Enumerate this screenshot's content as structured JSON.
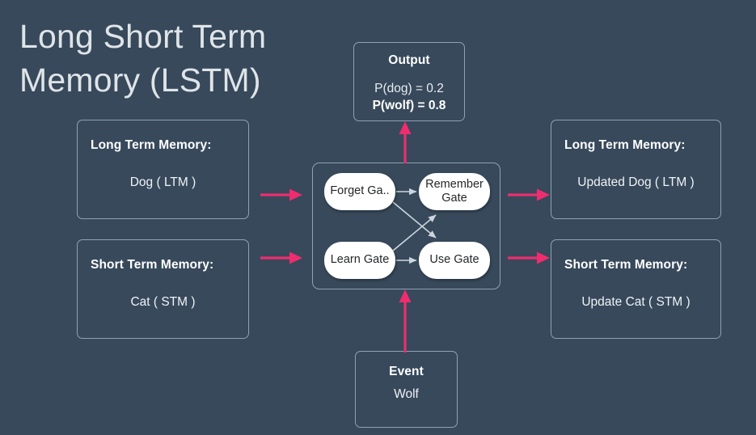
{
  "slide": {
    "title": "Long Short Term\nMemory (LSTM)",
    "background_color": "#37495b",
    "accent_color": "#ee2d6e",
    "box_border_color": "#8fa2b4",
    "gate_fill_color": "#ffffff",
    "text_color": "#ffffff"
  },
  "output_box": {
    "heading": "Output",
    "line1": "P(dog) = 0.2",
    "line2": "P(wolf) = 0.8"
  },
  "event_box": {
    "heading": "Event",
    "body": "Wolf"
  },
  "inputs": {
    "long_term_memory": {
      "heading": "Long Term Memory:",
      "body": "Dog ( LTM )"
    },
    "short_term_memory": {
      "heading": "Short Term Memory:",
      "body": "Cat ( STM )"
    }
  },
  "outputs": {
    "long_term_memory": {
      "heading": "Long Term Memory:",
      "body": "Updated Dog ( LTM )"
    },
    "short_term_memory": {
      "heading": "Short Term Memory:",
      "body": "Update Cat ( STM )"
    }
  },
  "gates": {
    "forget": "Forget Ga..",
    "remember": "Remember Gate",
    "learn": "Learn Gate",
    "use": "Use Gate"
  },
  "arrows": {
    "ltm_in": "arrow-right",
    "stm_in": "arrow-right",
    "ltm_out": "arrow-right",
    "stm_out": "arrow-right",
    "to_output": "arrow-up",
    "from_event": "arrow-up",
    "forget_to_remember": "arrow-right",
    "learn_to_use": "arrow-right",
    "forget_to_use": "arrow-diagonal-down-right",
    "learn_to_remember": "arrow-diagonal-up-right"
  }
}
